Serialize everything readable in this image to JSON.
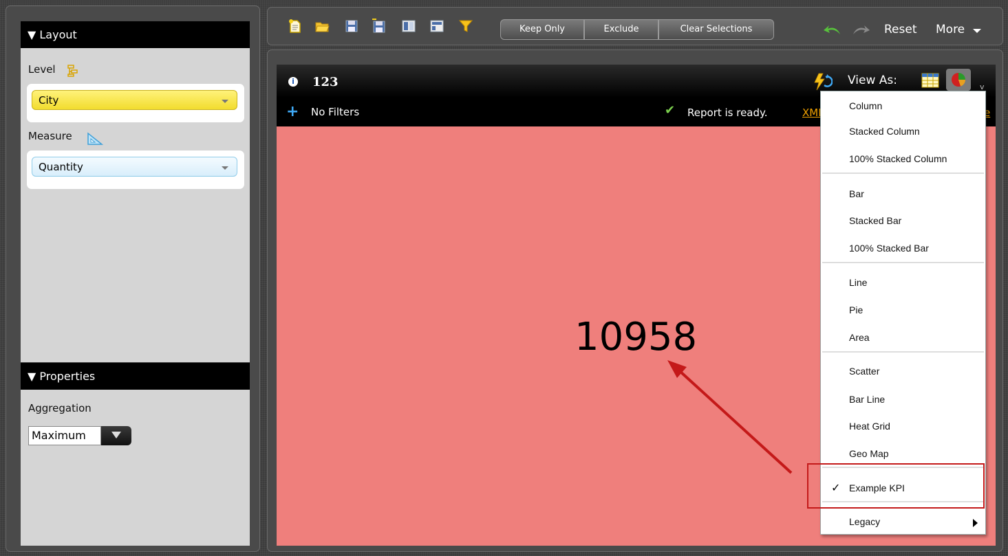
{
  "layout_panel": {
    "header": "▼ Layout",
    "level_label": "Level",
    "level_value": "City",
    "measure_label": "Measure",
    "measure_value": "Quantity"
  },
  "properties_panel": {
    "header": "▼ Properties",
    "aggregation_label": "Aggregation",
    "aggregation_value": "Maximum"
  },
  "toolbar": {
    "icons": [
      "new-report-icon",
      "open-folder-icon",
      "save-icon",
      "save-as-icon",
      "split-view-icon",
      "layout-view-icon",
      "filter-icon"
    ],
    "keep_only": "Keep Only",
    "exclude": "Exclude",
    "clear_selections": "Clear Selections",
    "reset": "Reset",
    "more": "More"
  },
  "report": {
    "title": "123",
    "filters_text": "No Filters",
    "status_text": "Report is ready.",
    "xml_link": "XML",
    "trailing_link": "e",
    "view_as_label": "View As:",
    "kpi_value": "10958"
  },
  "view_as_menu": {
    "items": [
      "Column",
      "Stacked Column",
      "100% Stacked Column",
      "Bar",
      "Stacked Bar",
      "100% Stacked Bar",
      "Line",
      "Pie",
      "Area",
      "Scatter",
      "Bar Line",
      "Heat Grid",
      "Geo Map",
      "Example KPI",
      "Legacy"
    ],
    "selected": "Example KPI"
  },
  "colors": {
    "report_background": "#ef7f7c",
    "level_combo": "#f5e13c",
    "measure_combo": "#dff1fb",
    "annotation": "#c41919"
  }
}
